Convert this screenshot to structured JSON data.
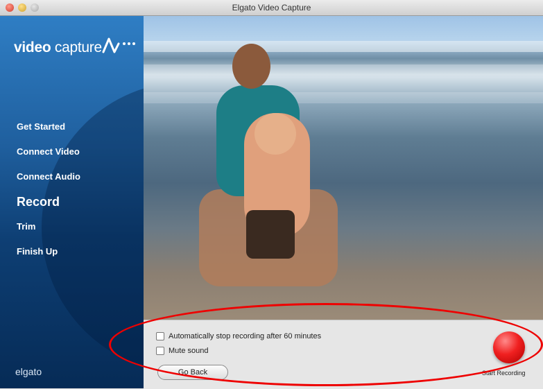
{
  "window": {
    "title": "Elgato Video Capture"
  },
  "sidebar": {
    "logo_bold": "video",
    "logo_thin": " capture",
    "items": [
      {
        "label": "Get Started"
      },
      {
        "label": "Connect Video"
      },
      {
        "label": "Connect Audio"
      },
      {
        "label": "Record",
        "active": true
      },
      {
        "label": "Trim"
      },
      {
        "label": "Finish Up"
      }
    ],
    "brand": "elgato"
  },
  "panel": {
    "auto_stop_label": "Automatically stop recording after 60 minutes",
    "mute_label": "Mute sound",
    "go_back_label": "Go Back",
    "record_label": "Start Recording"
  },
  "colors": {
    "record": "#e01818",
    "sidebar": "#1f5f9e",
    "annotation": "#e00000"
  }
}
